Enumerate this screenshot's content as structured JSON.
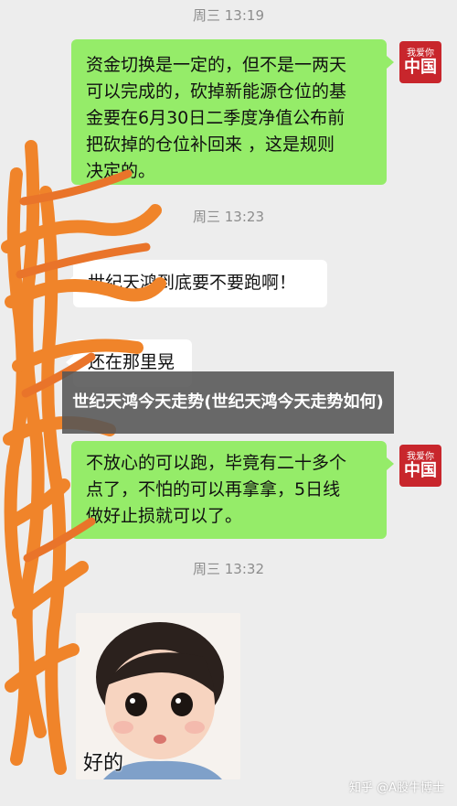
{
  "timestamps": [
    "周三 13:19",
    "周三 13:23",
    "周三 13:32"
  ],
  "avatar": {
    "small_text": "我爱你",
    "big_text": "中国"
  },
  "messages": [
    {
      "side": "right",
      "text": "资金切换是一定的，但不是一两天\n可以完成的，砍掉新能源仓位的基\n金要在6月30日二季度净值公布前\n把砍掉的仓位补回来 ，这是规则\n决定的。"
    },
    {
      "side": "left",
      "text": "世纪天鸿到底要不要跑啊！"
    },
    {
      "side": "left",
      "text": "还在那里晃"
    },
    {
      "side": "right",
      "text": "不放心的可以跑，毕竟有二十多个\n点了，不怕的可以再拿拿，5日线\n做好止损就可以了。"
    }
  ],
  "overlay_title": "世纪天鸿今天走势(世纪天鸿今天走势如何)",
  "sticker_caption": "好的",
  "watermark": "知乎 @A股牛博士",
  "colors": {
    "right_bubble": "#95ec69",
    "left_bubble": "#ffffff",
    "background": "#ededed",
    "scribble": "#f0842a",
    "avatar": "#c8262c"
  }
}
